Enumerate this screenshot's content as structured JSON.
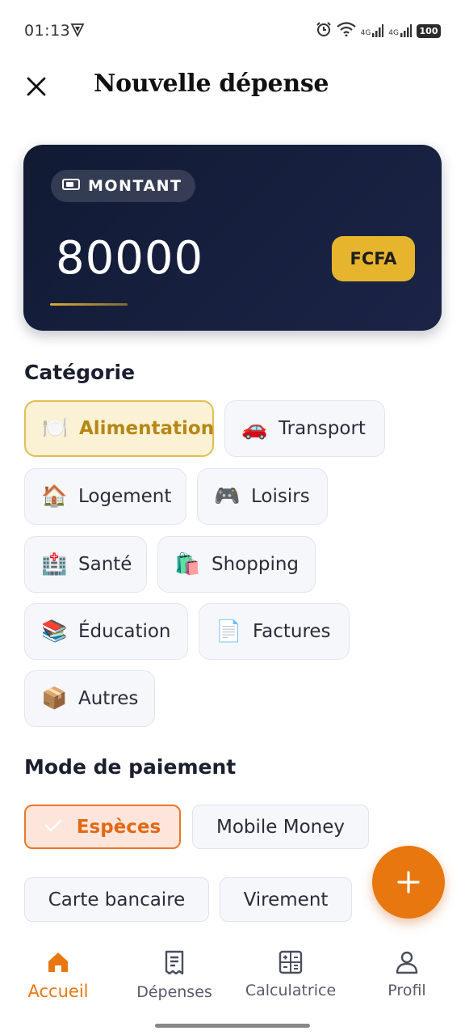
{
  "status_bar": {
    "time": "01:13",
    "network_labels": [
      "4G",
      "4G"
    ],
    "battery": "100"
  },
  "header": {
    "title": "Nouvelle dépense",
    "close_icon": "close-icon"
  },
  "amount_card": {
    "label": "MONTANT",
    "value": "80000",
    "currency": "FCFA",
    "colors": {
      "card": "#111a33",
      "accent": "#e7b52d"
    }
  },
  "categories": {
    "title": "Catégorie",
    "selected": "Alimentation",
    "items": [
      {
        "label": "Alimentation",
        "emoji": "🍽️"
      },
      {
        "label": "Transport",
        "emoji": "🚗"
      },
      {
        "label": "Logement",
        "emoji": "🏠"
      },
      {
        "label": "Loisirs",
        "emoji": "🎮"
      },
      {
        "label": "Santé",
        "emoji": "🏥"
      },
      {
        "label": "Shopping",
        "emoji": "🛍️"
      },
      {
        "label": "Éducation",
        "emoji": "📚"
      },
      {
        "label": "Factures",
        "emoji": "📄"
      },
      {
        "label": "Autres",
        "emoji": "📦"
      }
    ]
  },
  "payment": {
    "title": "Mode de paiement",
    "selected": "Espèces",
    "options": [
      {
        "label": "Espèces"
      },
      {
        "label": "Mobile Money"
      },
      {
        "label": "Carte bancaire"
      },
      {
        "label": "Virement"
      }
    ],
    "colors": {
      "selected": "#e8782a"
    }
  },
  "fab": {
    "icon": "plus-icon"
  },
  "bottom_nav": {
    "active": "Accueil",
    "items": [
      {
        "label": "Accueil",
        "icon": "home-icon"
      },
      {
        "label": "Dépenses",
        "icon": "receipt-icon"
      },
      {
        "label": "Calculatrice",
        "icon": "calculator-icon"
      },
      {
        "label": "Profil",
        "icon": "user-icon"
      }
    ],
    "colors": {
      "active": "#e8770f"
    }
  }
}
